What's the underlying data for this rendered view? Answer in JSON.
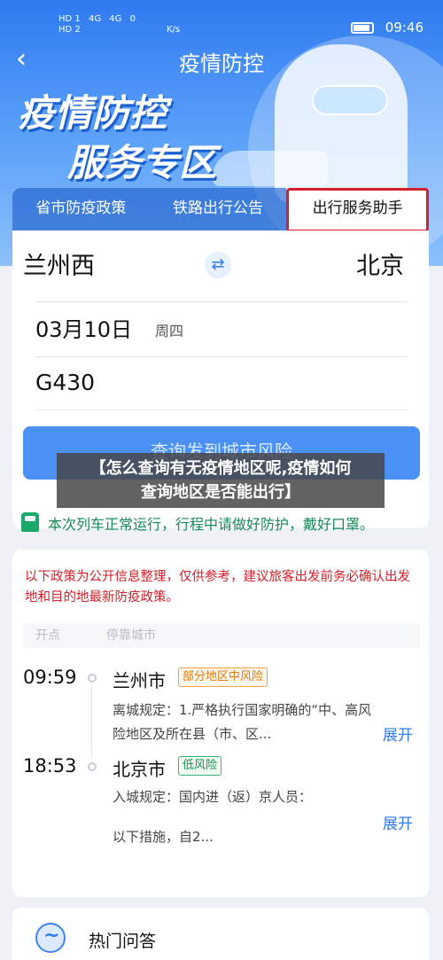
{
  "statusbar": {
    "sim1": "HD 1",
    "sim2": "HD 2",
    "net1": "4G",
    "net2": "4G",
    "speed": "0",
    "speed_unit": "K/s",
    "battery_icon": "battery-icon",
    "time": "09:46"
  },
  "header": {
    "back_icon": "chevron-left-icon",
    "title": "疫情防控",
    "hero_line1": "疫情防控",
    "hero_line2": "服务专区"
  },
  "tabs": [
    {
      "label": "省市防疫政策",
      "active": false
    },
    {
      "label": "铁路出行公告",
      "active": false
    },
    {
      "label": "出行服务助手",
      "active": true
    }
  ],
  "trip": {
    "from": "兰州西",
    "to": "北京",
    "swap_icon": "swap-icon",
    "date": "03月10日",
    "weekday": "周四",
    "train_number": "G430",
    "query_button": "查询发到城市风险"
  },
  "overlay_caption": {
    "line1": "【怎么查询有无疫情地区呢,疫情如何",
    "line2": "查询地区是否能出行】"
  },
  "notice": {
    "icon": "train-icon",
    "text": "本次列车正常运行，行程中请做好防护，戴好口罩。"
  },
  "policy": {
    "text": "以下政策为公开信息整理，仅供参考，建议旅客出发前务必确认出发地和目的地最新防疫政策。"
  },
  "route": {
    "header_departure": "开点",
    "header_stop": "停靠城市",
    "stops": [
      {
        "time": "09:59",
        "city": "兰州市",
        "risk": "部分地区中风险",
        "rule_line1": "离城规定：1.严格执行国家明确的“中、高风",
        "rule_line2": "险地区及所在县（市、区...",
        "expand": "展开"
      },
      {
        "time": "18:53",
        "city": "北京市",
        "risk": "低风险",
        "rule_line1": "入城规定：国内进（返）京人员：",
        "rule_line2": "以下措施，自2...",
        "expand": "展开"
      }
    ]
  },
  "faq": {
    "icon": "chat-icon",
    "label": "热门问答"
  },
  "colors": {
    "primary": "#2f7bf0",
    "alert_red": "#d6202a",
    "mid_risk": "#e07b12",
    "low_risk": "#15934e"
  }
}
